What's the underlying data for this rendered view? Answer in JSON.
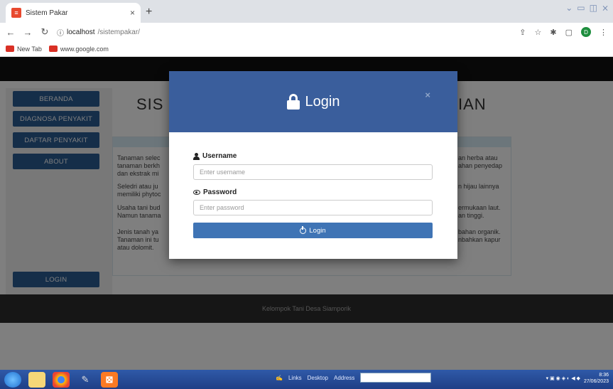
{
  "browser": {
    "tab_title": "Sistem Pakar",
    "tab_close": "×",
    "new_tab": "+",
    "url_host": "localhost",
    "url_path": "/sistempakar/",
    "bookmarks": [
      {
        "label": "New Tab"
      },
      {
        "label": "www.google.com"
      }
    ],
    "profile_initial": "D"
  },
  "sidebar": {
    "items": [
      {
        "label": "BERANDA"
      },
      {
        "label": "DIAGNOSA PENYAKIT"
      },
      {
        "label": "DAFTAR PENYAKIT"
      },
      {
        "label": "ABOUT"
      }
    ],
    "login_label": "LOGIN"
  },
  "main": {
    "title_left": "SIS",
    "title_right": "IAN",
    "paragraphs_left": [
      "Tanaman selec\ntanaman berkh\ndan ekstrak mi",
      "Seledri atau ju\nmemiliki phytoc",
      "Usaha tani bud\nNamun tanama",
      "Jenis tanah ya\nTanaman ini tu\natau dolomit."
    ],
    "paragraphs_right": [
      "an herba atau\nahan penyedap",
      "n hijau lainnya",
      "ermukaan laut.\nan tinggi.",
      "bahan organik.\nnbahkan kapur"
    ]
  },
  "footer": {
    "text": "Kelompok Tani Desa Siamporik"
  },
  "modal": {
    "title": "Login",
    "close": "×",
    "username_label": "Username",
    "username_placeholder": "Enter username",
    "password_label": "Password",
    "password_placeholder": "Enter password",
    "submit_label": "Login"
  },
  "taskbar": {
    "links": "Links",
    "desktop": "Desktop",
    "address": "Address",
    "time": "8:36",
    "date": "27/06/2023"
  },
  "colors": {
    "modal_header": "#3a5e9c",
    "login_button": "#3f74b5",
    "sidebar_button": "#2a5c93"
  }
}
